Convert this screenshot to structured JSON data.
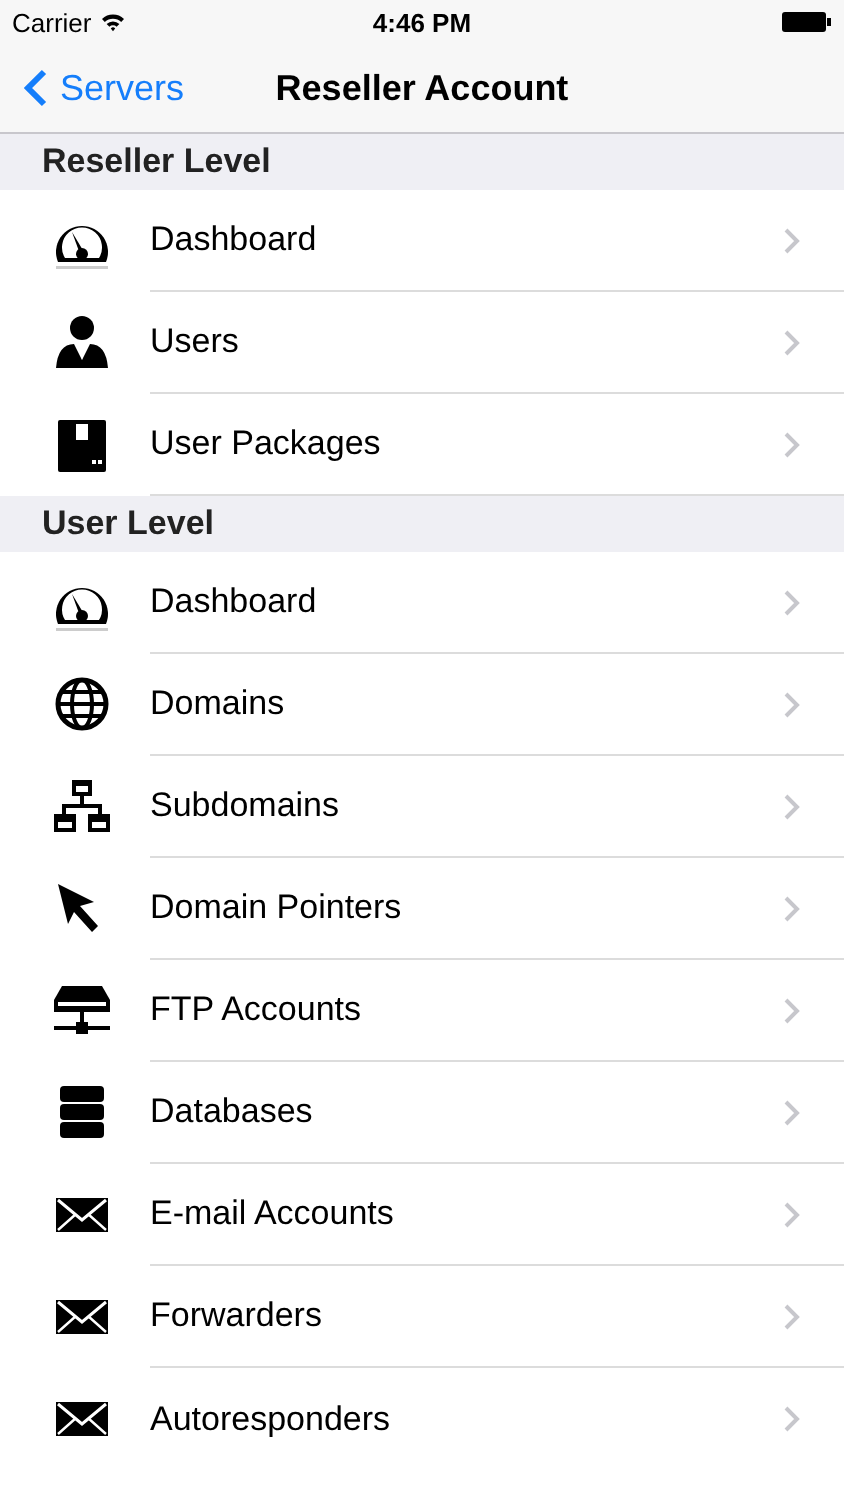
{
  "status_bar": {
    "carrier": "Carrier",
    "time": "4:46 PM"
  },
  "nav_bar": {
    "back": "Servers",
    "title": "Reseller Account"
  },
  "sections": [
    {
      "title": "Reseller Level",
      "items": [
        {
          "label": "Dashboard",
          "kind": "gauge"
        },
        {
          "label": "Users",
          "kind": "user"
        },
        {
          "label": "User Packages",
          "kind": "package"
        }
      ]
    },
    {
      "title": "User Level",
      "items": [
        {
          "label": "Dashboard",
          "kind": "gauge"
        },
        {
          "label": "Domains",
          "kind": "globe"
        },
        {
          "label": "Subdomains",
          "kind": "sitemap"
        },
        {
          "label": "Domain Pointers",
          "kind": "cursor"
        },
        {
          "label": "FTP Accounts",
          "kind": "ftp"
        },
        {
          "label": "Databases",
          "kind": "database"
        },
        {
          "label": "E-mail Accounts",
          "kind": "mail"
        },
        {
          "label": "Forwarders",
          "kind": "mail"
        },
        {
          "label": "Autoresponders",
          "kind": "mail"
        }
      ]
    }
  ]
}
